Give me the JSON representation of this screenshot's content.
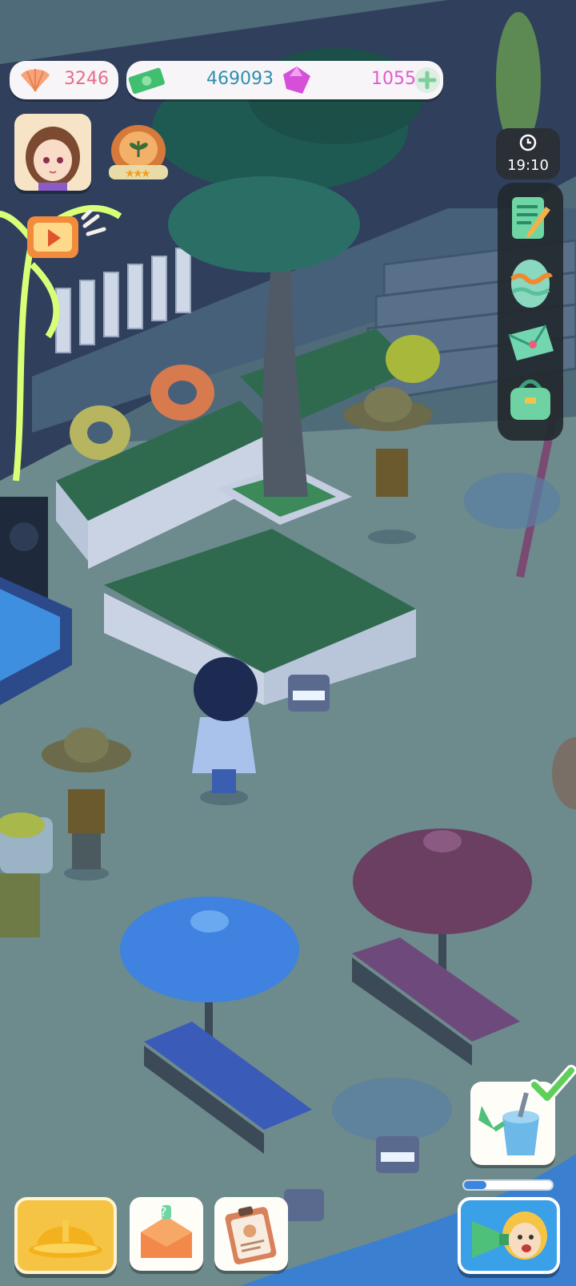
{
  "hud": {
    "shells": "3246",
    "cash": "469093",
    "gems": "1055",
    "time": "19:10"
  },
  "colors": {
    "shell_text": "#e86b8a",
    "cash_text": "#2f8fb0",
    "gem_text": "#e05ad0",
    "accent_green": "#5fcf5a",
    "button_yellow": "#f6c444",
    "button_blue": "#3aa0e8"
  },
  "icons": {
    "sidebar": [
      "clipboard-icon",
      "easter-egg-icon",
      "mail-icon",
      "bag-icon"
    ],
    "bottom": [
      "hard-hat-icon",
      "toolbox-icon",
      "recipe-board-icon",
      "megaphone-worker-icon"
    ]
  },
  "progress": {
    "worker_bar": 0.25
  }
}
